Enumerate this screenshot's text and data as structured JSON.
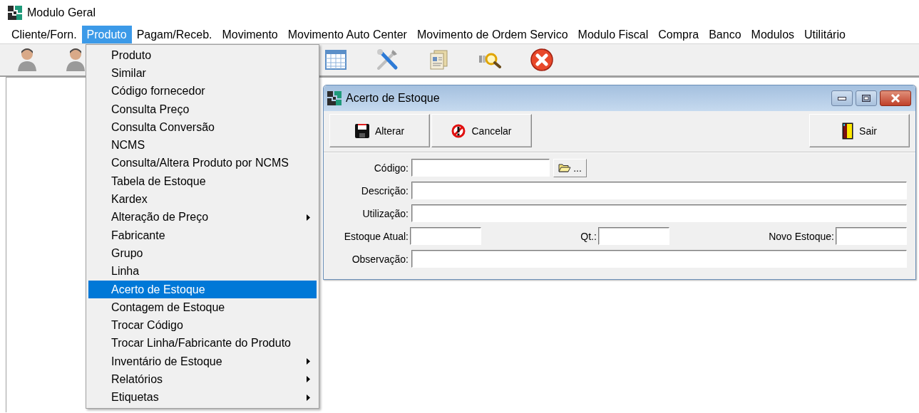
{
  "app": {
    "title": "Modulo Geral"
  },
  "menubar": [
    {
      "label": "Cliente/Forn.",
      "selected": false
    },
    {
      "label": "Produto",
      "selected": true
    },
    {
      "label": "Pagam/Receb.",
      "selected": false
    },
    {
      "label": "Movimento",
      "selected": false
    },
    {
      "label": "Movimento Auto Center",
      "selected": false
    },
    {
      "label": "Movimento de Ordem Servico",
      "selected": false
    },
    {
      "label": "Modulo Fiscal",
      "selected": false
    },
    {
      "label": "Compra",
      "selected": false
    },
    {
      "label": "Banco",
      "selected": false
    },
    {
      "label": "Modulos",
      "selected": false
    },
    {
      "label": "Utilitário",
      "selected": false
    }
  ],
  "toolbar": {
    "left": [
      {
        "kind": "person"
      },
      {
        "kind": "person"
      }
    ],
    "right": [
      {
        "kind": "grid"
      },
      {
        "kind": "tools"
      },
      {
        "kind": "documents"
      },
      {
        "kind": "search"
      },
      {
        "kind": "close"
      }
    ]
  },
  "menu": {
    "items": [
      {
        "label": "Produto",
        "submenu": false,
        "selected": false
      },
      {
        "label": "Similar",
        "submenu": false,
        "selected": false
      },
      {
        "label": "Código fornecedor",
        "submenu": false,
        "selected": false
      },
      {
        "label": "Consulta Preço",
        "submenu": false,
        "selected": false
      },
      {
        "label": "Consulta Conversão",
        "submenu": false,
        "selected": false
      },
      {
        "label": "NCMS",
        "submenu": false,
        "selected": false
      },
      {
        "label": "Consulta/Altera Produto por NCMS",
        "submenu": false,
        "selected": false
      },
      {
        "label": "Tabela de Estoque",
        "submenu": false,
        "selected": false
      },
      {
        "label": "Kardex",
        "submenu": false,
        "selected": false
      },
      {
        "label": "Alteração de Preço",
        "submenu": true,
        "selected": false
      },
      {
        "label": "Fabricante",
        "submenu": false,
        "selected": false
      },
      {
        "label": "Grupo",
        "submenu": false,
        "selected": false
      },
      {
        "label": "Linha",
        "submenu": false,
        "selected": false
      },
      {
        "label": "Acerto de Estoque",
        "submenu": false,
        "selected": true
      },
      {
        "label": "Contagem de Estoque",
        "submenu": false,
        "selected": false
      },
      {
        "label": "Trocar Código",
        "submenu": false,
        "selected": false
      },
      {
        "label": "Trocar Linha/Fabricante do Produto",
        "submenu": false,
        "selected": false
      },
      {
        "label": "Inventário de Estoque",
        "submenu": true,
        "selected": false
      },
      {
        "label": "Relatórios",
        "submenu": true,
        "selected": false
      },
      {
        "label": "Etiquetas",
        "submenu": true,
        "selected": false
      }
    ]
  },
  "window": {
    "title": "Acerto de Estoque",
    "buttons": [
      {
        "label": "Alterar",
        "kind": "save"
      },
      {
        "label": "Cancelar",
        "kind": "cancel"
      },
      {
        "label": "Sair",
        "kind": "exit"
      }
    ],
    "form": [
      [
        {
          "label": "Código:",
          "kind": "lookup",
          "browse": "..."
        }
      ],
      [
        {
          "label": "Descrição:",
          "kind": "wide"
        }
      ],
      [
        {
          "label": "Utilização:",
          "kind": "wide"
        }
      ],
      [
        {
          "label": "Estoque Atual:",
          "kind": "short"
        },
        {
          "label": "Qt.:",
          "kind": "short"
        },
        {
          "label": "Novo Estoque:",
          "kind": "short"
        }
      ],
      [
        {
          "label": "Observação:",
          "kind": "wide"
        }
      ]
    ]
  }
}
